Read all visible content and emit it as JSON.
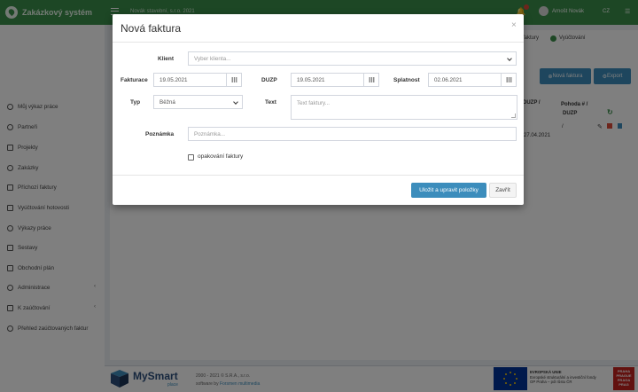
{
  "app": {
    "title": "Zakázkový systém",
    "company": "Novák stavební, s.r.o. 2021",
    "user_name": "Arnošt Novák",
    "language": "CZ"
  },
  "sidebar": {
    "items": [
      {
        "label": "Můj výkaz práce",
        "icon": "clock-icon"
      },
      {
        "label": "Partneři",
        "icon": "handshake-icon"
      },
      {
        "label": "Projekty",
        "icon": "folder-icon"
      },
      {
        "label": "Zakázky",
        "icon": "tag-icon"
      },
      {
        "label": "Příchozí faktury",
        "icon": "file-icon"
      },
      {
        "label": "Vyúčtování hotovosti",
        "icon": "money-icon"
      },
      {
        "label": "Výkazy práce",
        "icon": "clock-icon"
      },
      {
        "label": "Sestavy",
        "icon": "list-icon"
      },
      {
        "label": "Obchodní plán",
        "icon": "chart-icon"
      },
      {
        "label": "Administrace",
        "icon": "cogs-icon",
        "chevron": "‹"
      },
      {
        "label": "K zaúčtování",
        "icon": "book-icon",
        "chevron": "‹"
      },
      {
        "label": "Přehled zaúčtovaných faktur",
        "icon": "check-circle-icon"
      }
    ]
  },
  "background": {
    "tab_invoices": "faktury",
    "tab_billing": "Vyúčtování",
    "btn_new_invoice": "Nová faktura",
    "btn_export": "Export",
    "col_duzp": "DUZP /",
    "col_pohoda": "Pohoda # /",
    "col_pohoda_2": "DUZP",
    "cell_slash": "/",
    "cell_date": "27.04.2021"
  },
  "modal": {
    "title": "Nová faktura",
    "close_glyph": "×",
    "client_label": "Klient",
    "client_placeholder": "Vyber klienta...",
    "invoicing_label": "Fakturace",
    "invoicing_value": "19.05.2021",
    "duzp_label": "DUZP",
    "duzp_value": "19.05.2021",
    "due_label": "Splatnost",
    "due_value": "02.06.2021",
    "type_label": "Typ",
    "type_value": "Běžná",
    "text_label": "Text",
    "text_placeholder": "Text faktury...",
    "note_label": "Poznámka",
    "note_placeholder": "Poznámka...",
    "repeat_label": "opakování faktury",
    "repeat_checked": false,
    "save_button": "Uložit a upravit položky",
    "close_button": "Zavřít"
  },
  "footer": {
    "brand": "MySmart",
    "brand_sub": "place",
    "copyright": "2000 - 2021 © S.R.A., s.r.o.",
    "software_prefix": "software by",
    "software_vendor": "Forsmen multimedia",
    "eu_line1": "EVROPSKÁ UNIE",
    "eu_line2": "Evropské strukturální a investiční fondy",
    "eu_line3": "OP Praha – pól růstu ČR",
    "praha_logo": "PRAHA PRAGUE PRAGA PRAG"
  },
  "colors": {
    "topbar": "#3a8f4a",
    "primary_button": "#3c8dbc",
    "overlay": "rgba(0,0,0,0.5)"
  }
}
